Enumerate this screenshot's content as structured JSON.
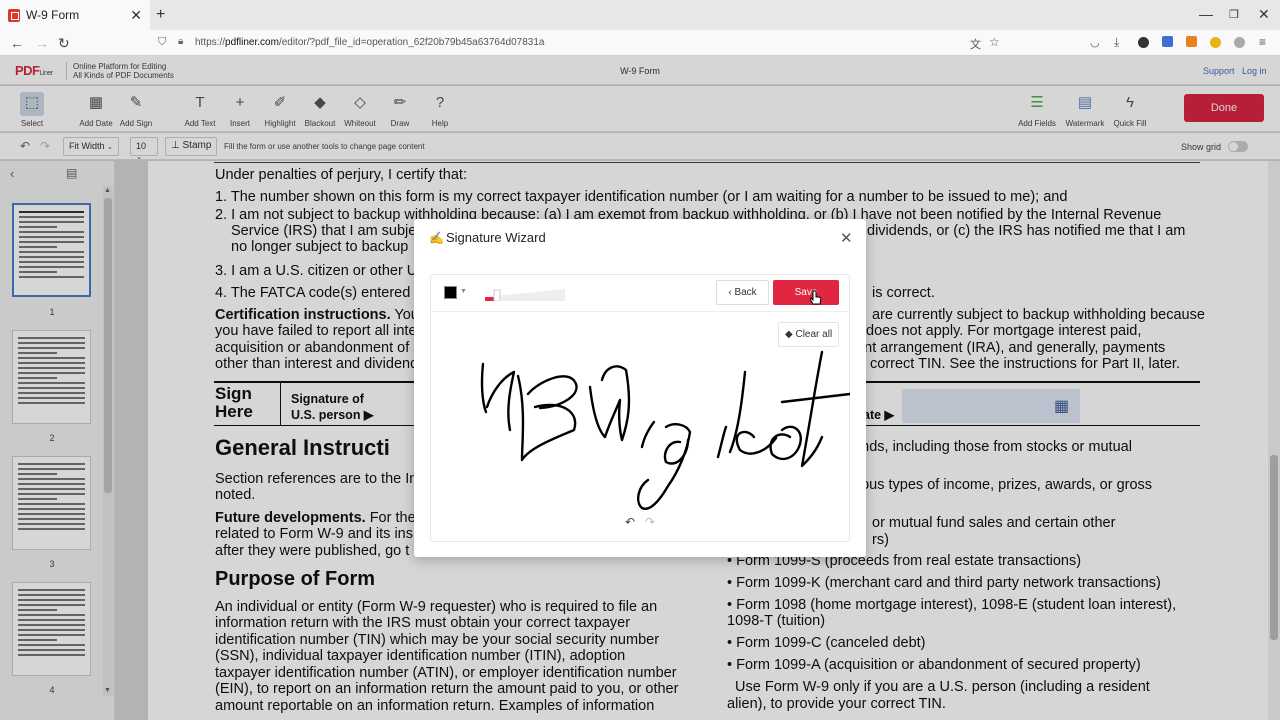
{
  "browser": {
    "tab_title": "W-9 Form",
    "url_prefix": "https://",
    "url_domain": "pdfliner.com",
    "url_path": "/editor/?pdf_file_id=operation_62f20b79b45a63764d07831a"
  },
  "app": {
    "logo_text": "PDF",
    "logo_sub": "Liner",
    "tagline_line1": "Online Platform for Editing",
    "tagline_line2": "All Kinds of PDF Documents",
    "document_title": "W-9 Form",
    "support": "Support",
    "login": "Log in"
  },
  "toolbar": {
    "left_tools": [
      {
        "label": "Select",
        "icon": "cursor-icon"
      },
      {
        "label": "Add Date",
        "icon": "calendar-icon"
      },
      {
        "label": "Add Sign",
        "icon": "pen-icon"
      },
      {
        "label": "Add Text",
        "icon": "text-icon"
      },
      {
        "label": "Insert",
        "icon": "plus-icon"
      },
      {
        "label": "Highlight",
        "icon": "highlighter-icon"
      },
      {
        "label": "Blackout",
        "icon": "blackout-icon"
      },
      {
        "label": "Whiteout",
        "icon": "eraser-icon"
      },
      {
        "label": "Draw",
        "icon": "pencil-icon"
      },
      {
        "label": "Help",
        "icon": "help-icon"
      }
    ],
    "right_tools": [
      {
        "label": "Add Fields",
        "icon": "fields-icon"
      },
      {
        "label": "Watermark",
        "icon": "watermark-icon"
      },
      {
        "label": "Quick Fill",
        "icon": "lightning-icon"
      }
    ],
    "done_label": "Done"
  },
  "subbar": {
    "zoom": "Fit Width",
    "font_size": "10",
    "stamp_label": "Stamp",
    "hint": "Fill the form or use another tools to change page content",
    "show_grid": "Show grid"
  },
  "sidebar": {
    "pages": [
      "1",
      "2",
      "3",
      "4"
    ]
  },
  "document": {
    "lines": [
      "Under penalties of perjury, I certify that:",
      "1. The number shown on this form is my correct taxpayer identification number (or I am waiting for a number to be issued to me); and",
      "2. I am not subject to backup withholding because: (a) I am exempt from backup withholding, or (b) I have not been notified by the Internal Revenue",
      "Service (IRS) that I am subje",
      "no longer subject to backup",
      "3. I am a U.S. citizen or other U",
      "4. The FATCA code(s) entered",
      "you have failed to report all inter",
      "acquisition or abandonment of s",
      "other than interest and dividends"
    ],
    "cert_bold": "Certification instructions.",
    "cert_rest": " You",
    "right_frag1": "dividends, or (c) the IRS has notified me that I am",
    "right_frag2": "is correct.",
    "right_frag3": "are currently subject to backup withholding because",
    "right_frag4": "does not apply. For mortgage interest paid,",
    "right_frag5": "ment arrangement (IRA), and generally, payments",
    "right_frag6": "correct TIN. See the instructions for Part II, later.",
    "sign_here_1": "Sign",
    "sign_here_2": "Here",
    "sig_of_1": "Signature of",
    "sig_of_2": "U.S. person ▶",
    "date_label": "ate ▶",
    "heading_general": "General Instructi",
    "section_refs_1": "Section references are to the In",
    "section_refs_2": "noted.",
    "future_bold": "Future developments.",
    "future_rest": " For the",
    "future_2": "related to Form W-9 and its ins",
    "future_3": "after they were published, go t",
    "heading_purpose": "Purpose of Form",
    "purpose_lines": [
      "An individual or entity (Form W-9 requester) who is required to file an",
      "information return with the IRS must obtain your correct taxpayer",
      "identification number (TIN) which may be your social security number",
      "(SSN), individual taxpayer identification number (ITIN), adoption",
      "taxpayer identification number (ATIN), or employer identification number",
      "(EIN), to report on an information return the amount paid to you, or other",
      "amount reportable on an information return. Examples of information"
    ],
    "right_col": [
      "dends, including those from stocks or mutual",
      "arious types of income, prizes, awards, or gross",
      "or mutual fund sales and certain other",
      "rs)",
      "• Form 1099-S (proceeds from real estate transactions)",
      "• Form 1099-K (merchant card and third party network transactions)",
      "• Form 1098 (home mortgage interest), 1098-E (student loan interest),",
      "1098-T (tuition)",
      "• Form 1099-C (canceled debt)",
      "• Form 1099-A (acquisition or abandonment of secured property)",
      "  Use Form W-9 only if you are a U.S. person (including a resident",
      "alien), to provide your correct TIN."
    ]
  },
  "modal": {
    "title": "Signature Wizard",
    "back_label": "Back",
    "save_label": "Save",
    "clear_all_label": "Clear all",
    "pen_color": "#000000",
    "pen_width": 0.15
  }
}
